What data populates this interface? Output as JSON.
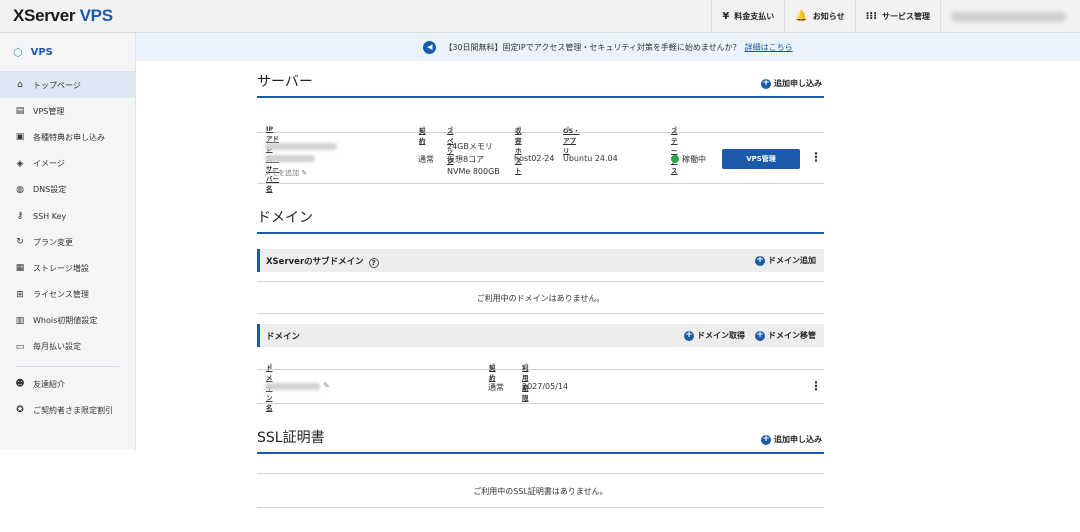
{
  "header": {
    "logo_x": "XServer",
    "logo_v": "VPS",
    "nav": [
      {
        "icon": "yen-icon",
        "label": "料金支払い"
      },
      {
        "icon": "bell-icon",
        "label": "お知らせ"
      },
      {
        "icon": "grid-icon",
        "label": "サービス管理"
      }
    ]
  },
  "sidebar": {
    "title": "VPS",
    "items": [
      {
        "icon": "home-icon",
        "label": "トップページ"
      },
      {
        "icon": "server-icon",
        "label": "VPS管理"
      },
      {
        "icon": "gift-icon",
        "label": "各種特典お申し込み"
      },
      {
        "icon": "layers-icon",
        "label": "イメージ"
      },
      {
        "icon": "globe-icon",
        "label": "DNS設定"
      },
      {
        "icon": "key-icon",
        "label": "SSH Key"
      },
      {
        "icon": "refresh-icon",
        "label": "プラン変更"
      },
      {
        "icon": "storage-icon",
        "label": "ストレージ増設"
      },
      {
        "icon": "windows-icon",
        "label": "ライセンス管理"
      },
      {
        "icon": "document-icon",
        "label": "Whois初期値設定"
      },
      {
        "icon": "card-icon",
        "label": "毎月払い設定"
      }
    ],
    "extra": [
      {
        "icon": "user-icon",
        "label": "友達紹介"
      },
      {
        "icon": "discount-icon",
        "label": "ご契約者さま限定割引"
      }
    ]
  },
  "banner": {
    "text": "【30日間無料】固定IPでアクセス管理・セキュリティ対策を手軽に始めませんか？",
    "link": "詳細はこちら"
  },
  "server": {
    "title": "サーバー",
    "add": "追加申し込み",
    "columns": [
      "IPアドレス・サーバー名",
      "契約",
      "スペック",
      "収容ホスト",
      "OS・アプリ",
      "ステータス"
    ],
    "row": {
      "memo": "メモを追加",
      "contract": "通常",
      "spec1": "24GBメモリ",
      "spec2": "仮想8コア",
      "spec3": "NVMe 800GB",
      "host": "host02-24",
      "os": "Ubuntu 24.04",
      "status": "稼働中",
      "button": "VPS管理"
    }
  },
  "domain": {
    "title": "ドメイン",
    "sub_title": "XServerのサブドメイン",
    "sub_add": "ドメイン追加",
    "sub_empty": "ご利用中のドメインはありません。",
    "list_title": "ドメイン",
    "acquire": "ドメイン取得",
    "transfer": "ドメイン移管",
    "columns": [
      "ドメイン名",
      "契約",
      "利用期限"
    ],
    "row": {
      "contract": "通常",
      "expiry": "2027/05/14"
    }
  },
  "ssl": {
    "title": "SSL証明書",
    "add": "追加申し込み",
    "empty": "ご利用中のSSL証明書はありません。"
  }
}
